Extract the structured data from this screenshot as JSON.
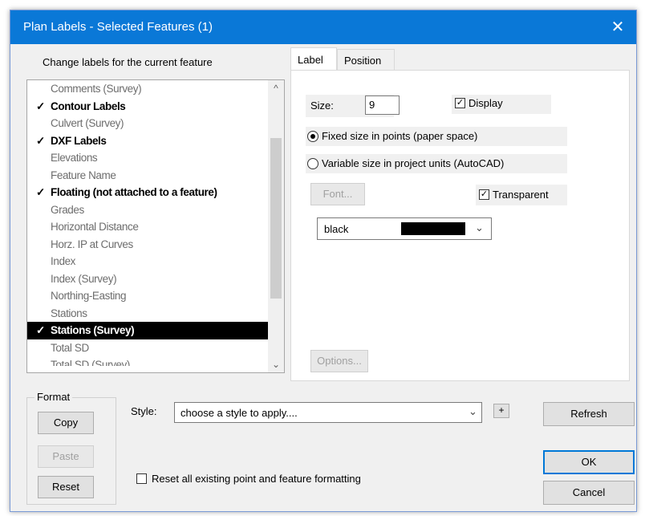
{
  "dialog": {
    "title": "Plan Labels - Selected Features (1)",
    "close_glyph": "✕"
  },
  "list_caption": "Change labels for the current feature",
  "features": [
    {
      "label": "Comments (Survey)",
      "checked": false,
      "selected": false
    },
    {
      "label": "Contour Labels",
      "checked": true,
      "selected": false
    },
    {
      "label": "Culvert (Survey)",
      "checked": false,
      "selected": false
    },
    {
      "label": "DXF Labels",
      "checked": true,
      "selected": false
    },
    {
      "label": "Elevations",
      "checked": false,
      "selected": false
    },
    {
      "label": "Feature Name",
      "checked": false,
      "selected": false
    },
    {
      "label": "Floating (not attached to a feature)",
      "checked": true,
      "selected": false
    },
    {
      "label": "Grades",
      "checked": false,
      "selected": false
    },
    {
      "label": "Horizontal Distance",
      "checked": false,
      "selected": false
    },
    {
      "label": "Horz. IP at Curves",
      "checked": false,
      "selected": false
    },
    {
      "label": "Index",
      "checked": false,
      "selected": false
    },
    {
      "label": "Index (Survey)",
      "checked": false,
      "selected": false
    },
    {
      "label": "Northing-Easting",
      "checked": false,
      "selected": false
    },
    {
      "label": "Stations",
      "checked": false,
      "selected": false
    },
    {
      "label": "Stations (Survey)",
      "checked": true,
      "selected": true
    },
    {
      "label": "Total SD",
      "checked": false,
      "selected": false
    },
    {
      "label": "Total SD (Survey)",
      "checked": false,
      "selected": false
    }
  ],
  "checkmark": "✓",
  "tabs": [
    {
      "label": "Label",
      "active": true
    },
    {
      "label": "Position",
      "active": false
    }
  ],
  "label_tab": {
    "size_label": "Size:",
    "size_value": "9",
    "display_label": "Display",
    "display_checked": true,
    "fixed_label": "Fixed size in points (paper space)",
    "variable_label": "Variable size in project units (AutoCAD)",
    "size_mode": "fixed",
    "font_button": "Font...",
    "transparent_label": "Transparent",
    "transparent_checked": true,
    "color_name": "black",
    "color_swatch": "#000000",
    "options_button": "Options..."
  },
  "format": {
    "group_label": "Format",
    "copy": "Copy",
    "paste": "Paste",
    "reset": "Reset"
  },
  "style": {
    "label": "Style:",
    "value": "choose a style to apply....",
    "add_glyph": "+"
  },
  "reset_all": {
    "label": "Reset all existing point and feature formatting",
    "checked": false
  },
  "buttons": {
    "refresh": "Refresh",
    "ok": "OK",
    "cancel": "Cancel"
  },
  "scroll": {
    "up": "^",
    "down": "⌄"
  },
  "accent_color": "#0a78d7"
}
